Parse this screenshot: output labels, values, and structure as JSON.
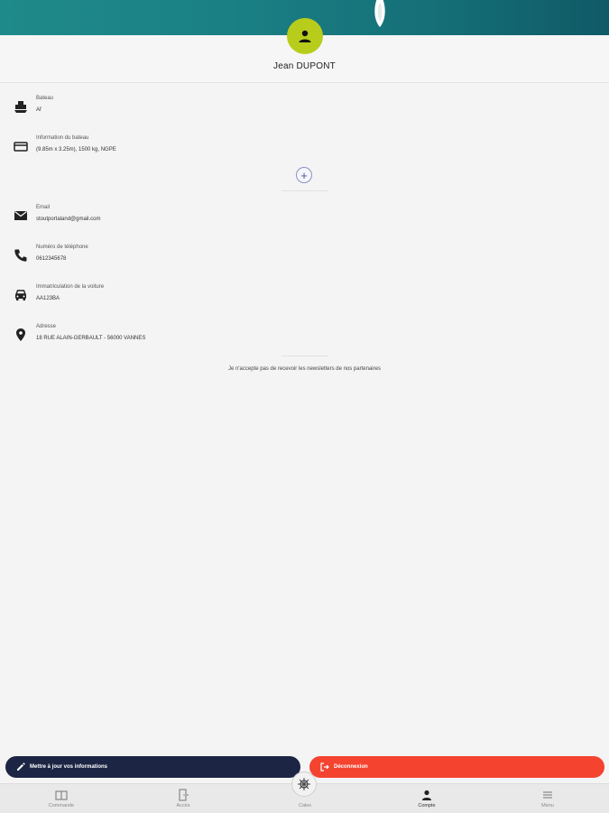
{
  "profile": {
    "name": "Jean DUPONT"
  },
  "boat_section": {
    "rows": [
      {
        "label": "Bateau",
        "value": "Af",
        "icon": "boat-icon"
      },
      {
        "label": "Information du bateau",
        "value": "(9.85m x 3.25m), 1500 kg, NGPE",
        "icon": "card-icon"
      }
    ],
    "add_icon": "plus-icon"
  },
  "contact_section": {
    "rows": [
      {
        "label": "Email",
        "value": "stoutportaland@gmail.com",
        "icon": "mail-icon"
      },
      {
        "label": "Numéro de téléphone",
        "value": "0612345678",
        "icon": "phone-icon"
      },
      {
        "label": "Immatriculation de la voiture",
        "value": "AA123BA",
        "icon": "car-icon"
      },
      {
        "label": "Adresse",
        "value": "18 RUE ALAIN-GERBAULT - 56000 VANNES",
        "icon": "location-pin-icon"
      }
    ]
  },
  "newsletter_text": "Je n'accepte pas de recevoir les newsletters de nos partenaires",
  "actions": {
    "update_label": "Mettre à jour vos informations",
    "logout_label": "Déconnexion"
  },
  "tabbar": {
    "tabs": [
      {
        "label": "Commande",
        "icon": "book-icon",
        "active": false
      },
      {
        "label": "Accès",
        "icon": "door-icon",
        "active": false
      },
      {
        "label": "Cales",
        "icon": "helm-icon",
        "active": false
      },
      {
        "label": "Compte",
        "icon": "person-icon",
        "active": true
      },
      {
        "label": "Menu",
        "icon": "menu-icon",
        "active": false
      }
    ]
  },
  "colors": {
    "avatar": "#b8cc1c",
    "update_button": "#1c2544",
    "logout_button": "#f4432f",
    "hero_water": "#1a7f84"
  }
}
